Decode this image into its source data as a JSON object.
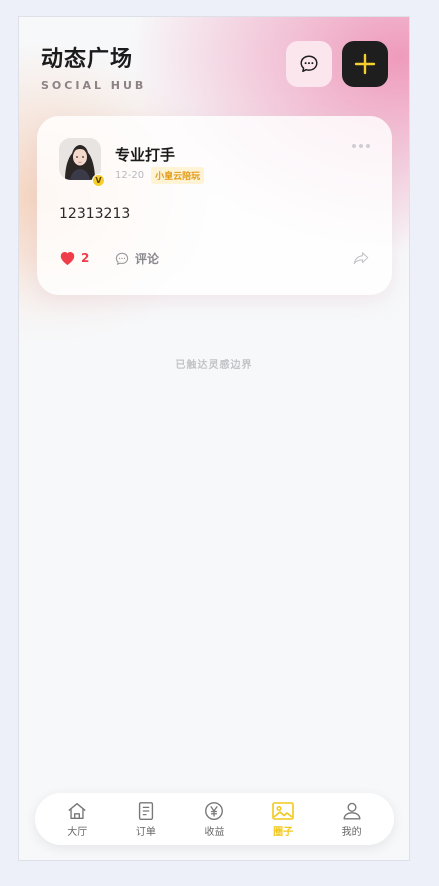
{
  "header": {
    "title": "动态广场",
    "subtitle": "SOCIAL HUB"
  },
  "top_buttons": [
    {
      "icon": "chat-bubble-icon",
      "name": "messages"
    },
    {
      "icon": "plus-icon",
      "name": "add-post",
      "accent": "#f6cf2e"
    }
  ],
  "post": {
    "username": "专业打手",
    "badge": "V",
    "time": "12-20",
    "tag": "小皇云陪玩",
    "content": "12313213",
    "likes": "2",
    "comment_label": "评论"
  },
  "feed_end_text": "已触达灵感边界",
  "tabbar": {
    "active": "circle",
    "items": [
      {
        "key": "hall",
        "label": "大厅",
        "icon": "home-icon"
      },
      {
        "key": "orders",
        "label": "订单",
        "icon": "document-icon"
      },
      {
        "key": "income",
        "label": "收益",
        "icon": "yen-circle-icon"
      },
      {
        "key": "circle",
        "label": "圈子",
        "icon": "image-icon"
      },
      {
        "key": "mine",
        "label": "我的",
        "icon": "user-icon"
      }
    ]
  },
  "colors": {
    "accent_yellow": "#f2c81c",
    "like_red": "#ef3e4a",
    "dark_button": "#1e1e1e"
  }
}
